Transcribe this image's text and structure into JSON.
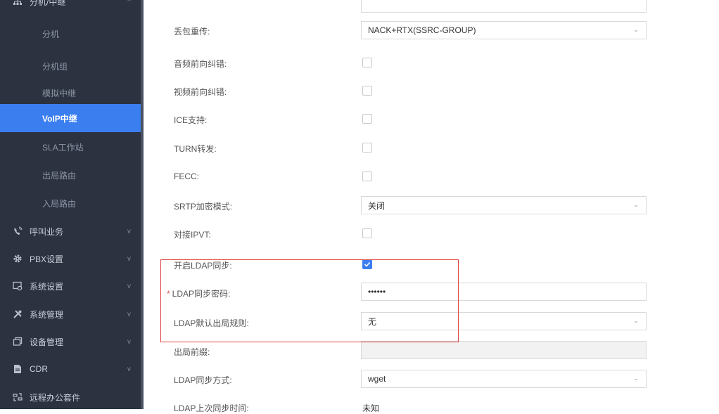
{
  "sidebar": {
    "header_label": "分机/中继",
    "sub_items": [
      {
        "label": "分机"
      },
      {
        "label": "分机组"
      },
      {
        "label": "模拟中继"
      },
      {
        "label": "VoIP中继"
      },
      {
        "label": "SLA工作站"
      },
      {
        "label": "出局路由"
      },
      {
        "label": "入局路由"
      }
    ],
    "top_items": [
      {
        "label": "呼叫业务",
        "icon": "phone-icon"
      },
      {
        "label": "PBX设置",
        "icon": "gear-icon"
      },
      {
        "label": "系统设置",
        "icon": "monitor-settings-icon"
      },
      {
        "label": "系统管理",
        "icon": "tools-icon"
      },
      {
        "label": "设备管理",
        "icon": "device-icon"
      },
      {
        "label": "CDR",
        "icon": "document-icon"
      },
      {
        "label": "远程办公套件",
        "icon": "remote-office-icon"
      }
    ],
    "active_index": 3
  },
  "form": {
    "packet_loss": {
      "label": "丢包重传:",
      "value": "NACK+RTX(SSRC-GROUP)"
    },
    "audio_fec": {
      "label": "音频前向纠错:"
    },
    "video_fec": {
      "label": "视频前向纠错:"
    },
    "ice": {
      "label": "ICE支持:"
    },
    "turn": {
      "label": "TURN转发:"
    },
    "fecc": {
      "label": "FECC:"
    },
    "srtp": {
      "label": "SRTP加密模式:",
      "value": "关闭"
    },
    "ipvt": {
      "label": "对接IPVT:"
    },
    "ldap_sync": {
      "label": "开启LDAP同步:",
      "checked": true
    },
    "ldap_password": {
      "label": "LDAP同步密码:",
      "value": "••••••",
      "required_mark": "*"
    },
    "ldap_outbound_rule": {
      "label": "LDAP默认出局规则:",
      "value": "无"
    },
    "outbound_prefix": {
      "label": "出局前缀:",
      "value": ""
    },
    "ldap_sync_method": {
      "label": "LDAP同步方式:",
      "value": "wget"
    },
    "ldap_last_sync": {
      "label": "LDAP上次同步时间:",
      "value": "未知"
    }
  },
  "colors": {
    "sidebar_bg": "#2c3240",
    "active": "#3b7ef0",
    "highlight_border": "#e04040"
  }
}
